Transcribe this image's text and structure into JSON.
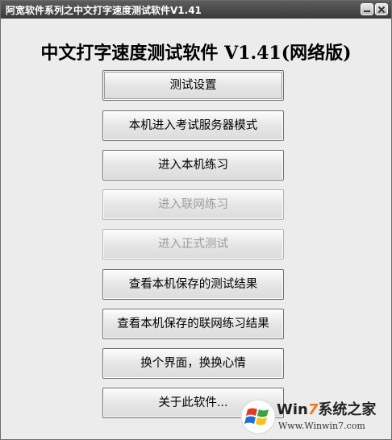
{
  "window": {
    "title": "阿宽软件系列之中文打字速度测试软件V1.41"
  },
  "heading": "中文打字速度测试软件  V1.41(网络版)",
  "buttons": [
    {
      "label": "测试设置",
      "enabled": true
    },
    {
      "label": "本机进入考试服务器模式",
      "enabled": true
    },
    {
      "label": "进入本机练习",
      "enabled": true
    },
    {
      "label": "进入联网练习",
      "enabled": false
    },
    {
      "label": "进入正式测试",
      "enabled": false
    },
    {
      "label": "查看本机保存的测试结果",
      "enabled": true
    },
    {
      "label": "查看本机保存的联网练习结果",
      "enabled": true
    },
    {
      "label": "换个界面，换换心情",
      "enabled": true
    },
    {
      "label": "关于此软件...",
      "enabled": true
    }
  ],
  "watermark": {
    "brand_prefix": "Win",
    "brand_num": "7",
    "brand_suffix": "系统之家",
    "url": "Www.Winwin7.com",
    "colors": {
      "orange": "#f07818",
      "blue": "#1c6fd1",
      "green": "#3aa53a",
      "red": "#e23b2a",
      "yellow": "#f7c21c"
    }
  }
}
